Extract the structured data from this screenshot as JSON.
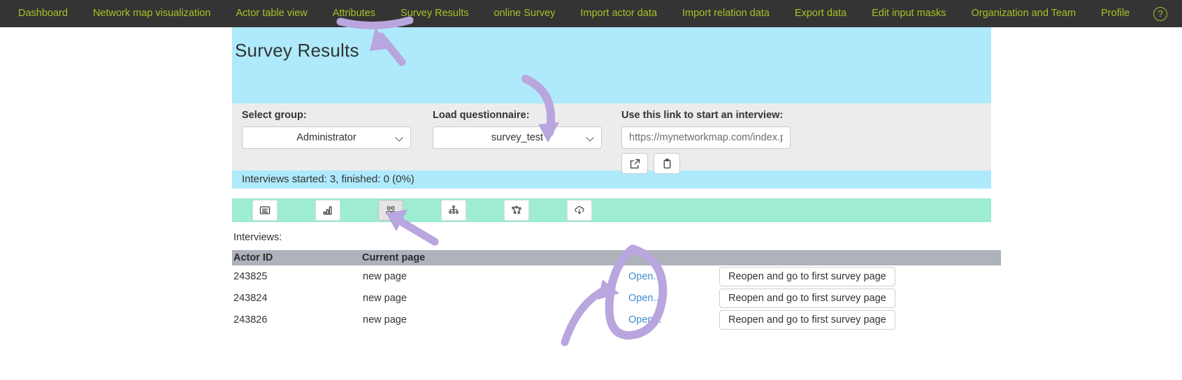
{
  "nav": {
    "items": [
      {
        "label": "Dashboard",
        "active": false
      },
      {
        "label": "Network map visualization",
        "active": false
      },
      {
        "label": "Actor table view",
        "active": false
      },
      {
        "label": "Attributes",
        "active": false
      },
      {
        "label": "Survey Results",
        "active": true
      },
      {
        "label": "online Survey",
        "active": false
      },
      {
        "label": "Import actor data",
        "active": false
      },
      {
        "label": "Import relation data",
        "active": false
      },
      {
        "label": "Export data",
        "active": false
      },
      {
        "label": "Edit input masks",
        "active": false
      },
      {
        "label": "Organization and Team",
        "active": false
      },
      {
        "label": "Profile",
        "active": false
      }
    ],
    "help_icon": "help-circle-icon",
    "help_glyph": "?"
  },
  "hero": {
    "title": "Survey Results"
  },
  "form": {
    "group": {
      "label": "Select group:",
      "value": "Administrator",
      "options": [
        "Administrator"
      ]
    },
    "questionnaire": {
      "label": "Load questionnaire:",
      "value": "survey_test",
      "options": [
        "survey_test"
      ]
    },
    "link": {
      "label": "Use this link to start an interview:",
      "value": "https://mynetworkmap.com/index.php?",
      "placeholder": "https://mynetworkmap.com/index.php?",
      "open_icon": "external-link-icon",
      "copy_icon": "clipboard-icon"
    }
  },
  "status": {
    "text": "Interviews started: 3, finished: 0 (0%)"
  },
  "toolbar": {
    "buttons": [
      {
        "icon": "document-text-icon",
        "selected": false
      },
      {
        "icon": "bar-chart-icon",
        "selected": false
      },
      {
        "icon": "people-group-icon",
        "selected": true
      },
      {
        "icon": "org-hierarchy-icon",
        "selected": false
      },
      {
        "icon": "network-graph-icon",
        "selected": false
      },
      {
        "icon": "cloud-download-icon",
        "selected": false
      }
    ]
  },
  "interviews": {
    "label": "Interviews:",
    "columns": [
      "Actor ID",
      "Current page",
      "",
      ""
    ],
    "open_label": "Open...",
    "reopen_label": "Reopen and go to first survey page",
    "rows": [
      {
        "actor_id": "243825",
        "current_page": "new page"
      },
      {
        "actor_id": "243824",
        "current_page": "new page"
      },
      {
        "actor_id": "243826",
        "current_page": "new page"
      }
    ]
  },
  "colors": {
    "nav_bg": "#343434",
    "nav_text": "#a3c325",
    "hero_bg": "#aeeafb",
    "panel_bg": "#ececec",
    "status_bg": "#aeeafb",
    "toolbar_bg": "#9eecd3",
    "table_header_bg": "#adb2bb",
    "link": "#3d8fd1",
    "annotation": "#b9a6de"
  }
}
